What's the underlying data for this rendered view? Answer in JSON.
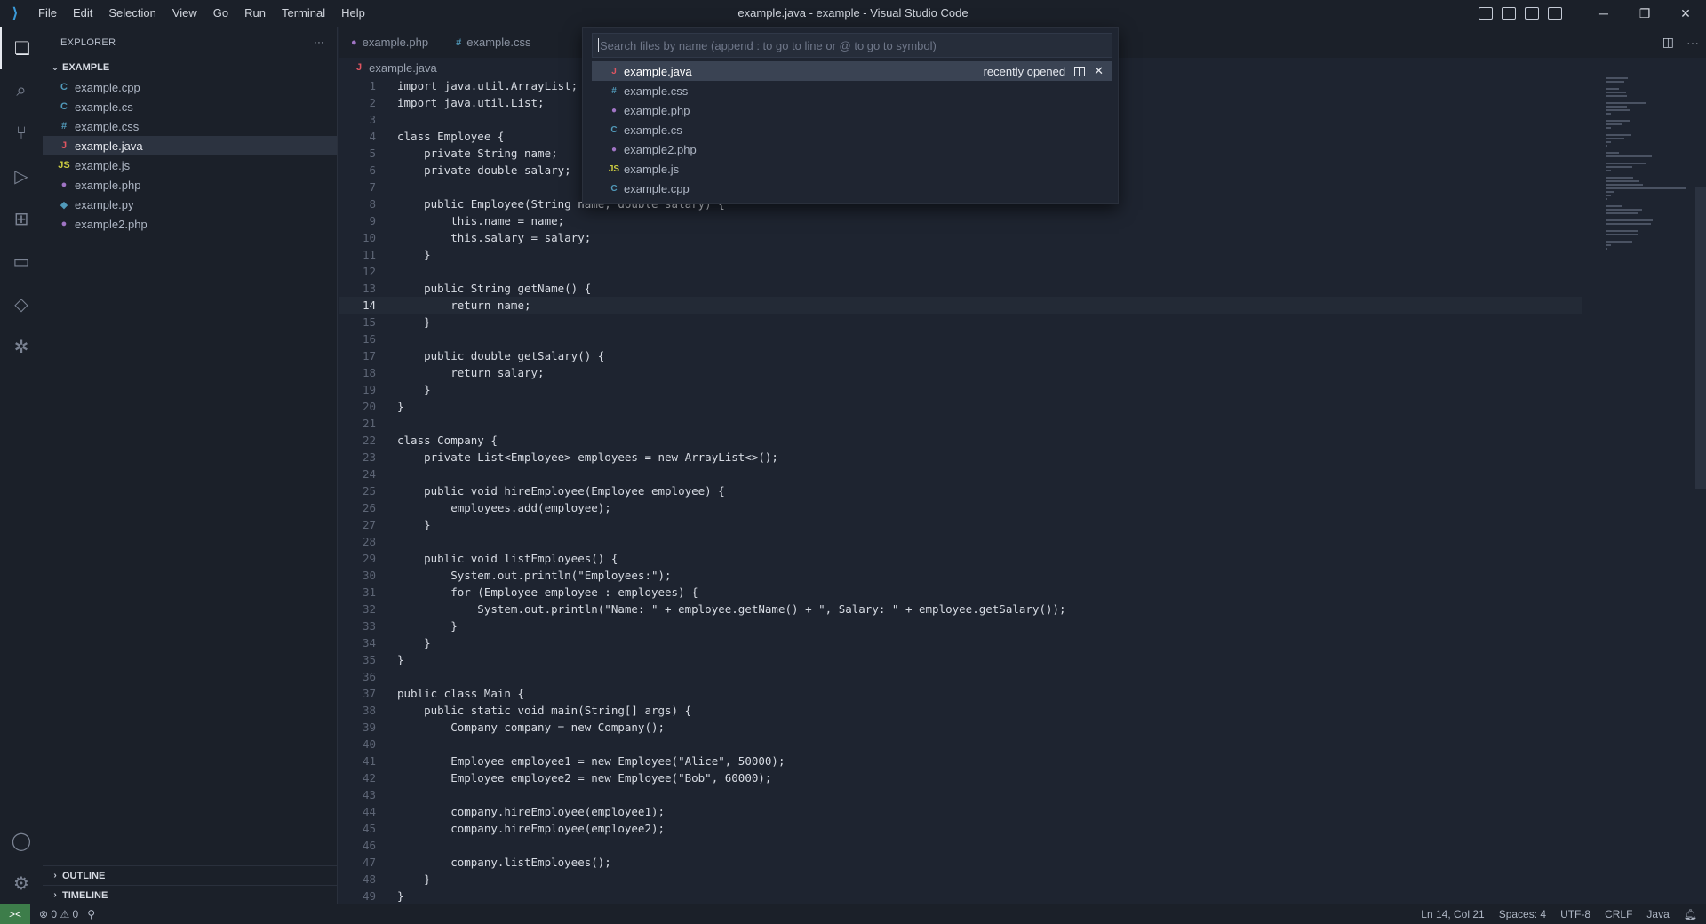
{
  "window": {
    "title": "example.java - example - Visual Studio Code",
    "menu": [
      "File",
      "Edit",
      "Selection",
      "View",
      "Go",
      "Run",
      "Terminal",
      "Help"
    ]
  },
  "sidebar": {
    "header": "EXPLORER",
    "more": "···",
    "folder": "EXAMPLE",
    "files": [
      {
        "name": "example.cpp",
        "icon": "C",
        "color": "#519aba"
      },
      {
        "name": "example.cs",
        "icon": "C",
        "color": "#519aba"
      },
      {
        "name": "example.css",
        "icon": "#",
        "color": "#519aba"
      },
      {
        "name": "example.java",
        "icon": "J",
        "color": "#e05561"
      },
      {
        "name": "example.js",
        "icon": "JS",
        "color": "#cbcb41"
      },
      {
        "name": "example.php",
        "icon": "●",
        "color": "#a074c4"
      },
      {
        "name": "example.py",
        "icon": "◆",
        "color": "#519aba"
      },
      {
        "name": "example2.php",
        "icon": "●",
        "color": "#a074c4"
      }
    ],
    "outline": "OUTLINE",
    "timeline": "TIMELINE"
  },
  "tabs": [
    {
      "name": "example.php",
      "icon": "●",
      "color": "#a074c4"
    },
    {
      "name": "example.css",
      "icon": "#",
      "color": "#519aba"
    }
  ],
  "breadcrumb": {
    "file": "example.java",
    "icon": "J"
  },
  "quick_open": {
    "placeholder": "Search files by name (append : to go to line or @ to go to symbol)",
    "items": [
      {
        "name": "example.java",
        "icon": "J",
        "color": "#e05561"
      },
      {
        "name": "example.css",
        "icon": "#",
        "color": "#519aba"
      },
      {
        "name": "example.php",
        "icon": "●",
        "color": "#a074c4"
      },
      {
        "name": "example.cs",
        "icon": "C",
        "color": "#519aba"
      },
      {
        "name": "example2.php",
        "icon": "●",
        "color": "#a074c4"
      },
      {
        "name": "example.js",
        "icon": "JS",
        "color": "#cbcb41"
      },
      {
        "name": "example.cpp",
        "icon": "C",
        "color": "#519aba"
      }
    ],
    "selected_meta": "recently opened"
  },
  "code": {
    "current_line": 14,
    "lines": [
      "import java.util.ArrayList;",
      "import java.util.List;",
      "",
      "class Employee {",
      "    private String name;",
      "    private double salary;",
      "",
      "    public Employee(String name, double salary) {",
      "        this.name = name;",
      "        this.salary = salary;",
      "    }",
      "",
      "    public String getName() {",
      "        return name;",
      "    }",
      "",
      "    public double getSalary() {",
      "        return salary;",
      "    }",
      "}",
      "",
      "class Company {",
      "    private List<Employee> employees = new ArrayList<>();",
      "",
      "    public void hireEmployee(Employee employee) {",
      "        employees.add(employee);",
      "    }",
      "",
      "    public void listEmployees() {",
      "        System.out.println(\"Employees:\");",
      "        for (Employee employee : employees) {",
      "            System.out.println(\"Name: \" + employee.getName() + \", Salary: \" + employee.getSalary());",
      "        }",
      "    }",
      "}",
      "",
      "public class Main {",
      "    public static void main(String[] args) {",
      "        Company company = new Company();",
      "",
      "        Employee employee1 = new Employee(\"Alice\", 50000);",
      "        Employee employee2 = new Employee(\"Bob\", 60000);",
      "",
      "        company.hireEmployee(employee1);",
      "        company.hireEmployee(employee2);",
      "",
      "        company.listEmployees();",
      "    }",
      "}"
    ]
  },
  "status": {
    "remote_icon": "><",
    "errors": "0",
    "warnings": "0",
    "position": "Ln 14, Col 21",
    "spaces": "Spaces: 4",
    "encoding": "UTF-8",
    "eol": "CRLF",
    "language": "Java"
  }
}
